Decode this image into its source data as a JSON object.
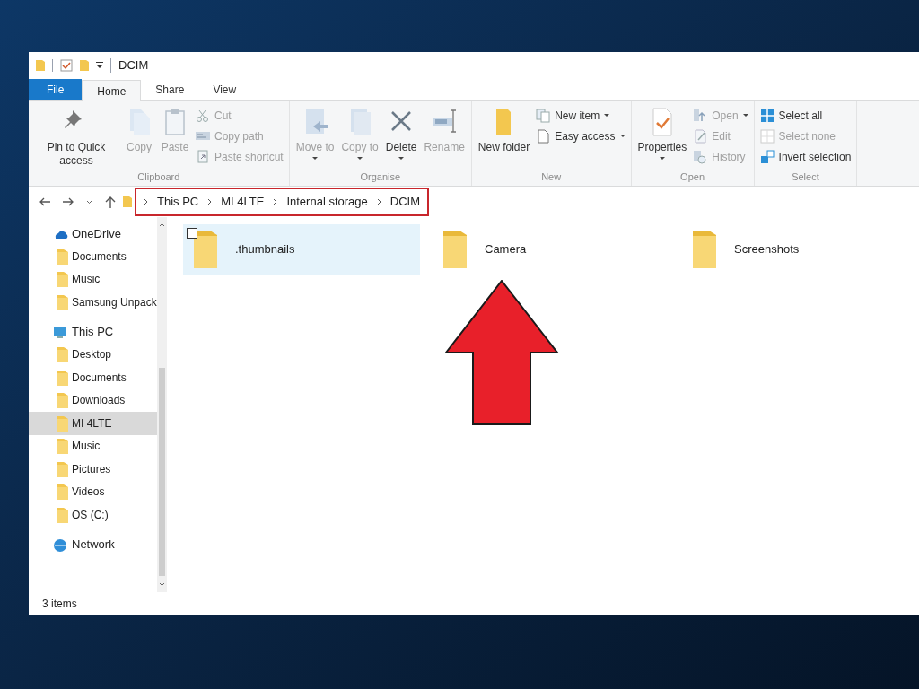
{
  "window": {
    "title": "DCIM"
  },
  "tabs": [
    {
      "label": "File",
      "kind": "file",
      "selected": false
    },
    {
      "label": "Home",
      "kind": "tab",
      "selected": true
    },
    {
      "label": "Share",
      "kind": "tab",
      "selected": false
    },
    {
      "label": "View",
      "kind": "tab",
      "selected": false
    }
  ],
  "ribbon": {
    "groups": [
      {
        "label": "Clipboard",
        "items": [
          {
            "kind": "large",
            "label": "Pin to Quick access",
            "disabled": false,
            "has_menu": false
          },
          {
            "kind": "large",
            "label": "Copy",
            "disabled": true,
            "has_menu": false
          },
          {
            "kind": "large",
            "label": "Paste",
            "disabled": true,
            "has_menu": false
          },
          {
            "kind": "stack",
            "items": [
              {
                "label": "Cut",
                "disabled": true,
                "has_menu": false
              },
              {
                "label": "Copy path",
                "disabled": true,
                "has_menu": false
              },
              {
                "label": "Paste shortcut",
                "disabled": true,
                "has_menu": false
              }
            ]
          }
        ]
      },
      {
        "label": "Organise",
        "items": [
          {
            "kind": "large",
            "label": "Move to",
            "disabled": true,
            "has_menu": true
          },
          {
            "kind": "large",
            "label": "Copy to",
            "disabled": true,
            "has_menu": true
          },
          {
            "kind": "large",
            "label": "Delete",
            "disabled": false,
            "has_menu": true
          },
          {
            "kind": "large",
            "label": "Rename",
            "disabled": true,
            "has_menu": false
          }
        ]
      },
      {
        "label": "New",
        "items": [
          {
            "kind": "large",
            "label": "New folder",
            "disabled": false,
            "has_menu": false
          },
          {
            "kind": "stack",
            "items": [
              {
                "label": "New item",
                "disabled": false,
                "has_menu": true
              },
              {
                "label": "Easy access",
                "disabled": false,
                "has_menu": true
              }
            ]
          }
        ]
      },
      {
        "label": "Open",
        "items": [
          {
            "kind": "large",
            "label": "Properties",
            "disabled": false,
            "has_menu": true
          },
          {
            "kind": "stack",
            "items": [
              {
                "label": "Open",
                "disabled": true,
                "has_menu": true
              },
              {
                "label": "Edit",
                "disabled": true,
                "has_menu": false
              },
              {
                "label": "History",
                "disabled": true,
                "has_menu": false
              }
            ]
          }
        ]
      },
      {
        "label": "Select",
        "items": [
          {
            "kind": "stack",
            "items": [
              {
                "label": "Select all",
                "disabled": false,
                "has_menu": false
              },
              {
                "label": "Select none",
                "disabled": true,
                "has_menu": false
              },
              {
                "label": "Invert selection",
                "disabled": false,
                "has_menu": false
              }
            ]
          }
        ]
      }
    ]
  },
  "address_bar": {
    "path": [
      "This PC",
      "MI 4LTE",
      "Internal storage",
      "DCIM"
    ]
  },
  "sidebar": {
    "items": [
      {
        "label": "OneDrive",
        "selected": false,
        "children": [
          {
            "label": "Documents",
            "selected": false
          },
          {
            "label": "Music",
            "selected": false
          },
          {
            "label": "Samsung Unpack",
            "selected": false
          }
        ]
      },
      {
        "label": "This PC",
        "selected": false,
        "children": [
          {
            "label": "Desktop",
            "selected": false
          },
          {
            "label": "Documents",
            "selected": false
          },
          {
            "label": "Downloads",
            "selected": false
          },
          {
            "label": "MI 4LTE",
            "selected": true
          },
          {
            "label": "Music",
            "selected": false
          },
          {
            "label": "Pictures",
            "selected": false
          },
          {
            "label": "Videos",
            "selected": false
          },
          {
            "label": "OS (C:)",
            "selected": false
          }
        ]
      },
      {
        "label": "Network",
        "selected": false
      }
    ]
  },
  "files": [
    {
      "name": ".thumbnails",
      "selected": true
    },
    {
      "name": "Camera",
      "selected": false
    },
    {
      "name": "Screenshots",
      "selected": false
    }
  ],
  "status_bar": {
    "item_count": "3 items"
  }
}
